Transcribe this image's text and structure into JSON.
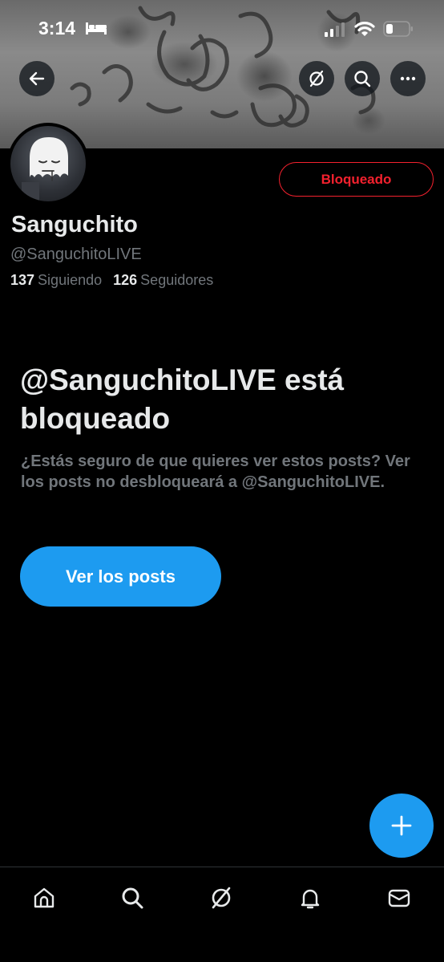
{
  "status_bar": {
    "time": "3:14",
    "icons": [
      "bed-icon",
      "signal-icon",
      "wifi-icon",
      "battery-icon"
    ]
  },
  "header": {
    "icons": [
      "back-arrow-icon",
      "grok-icon",
      "search-icon",
      "more-icon"
    ]
  },
  "profile": {
    "display_name": "Sanguchito",
    "handle": "@SanguchitoLIVE",
    "following_count": "137",
    "following_label": "Siguiendo",
    "followers_count": "126",
    "followers_label": "Seguidores",
    "blocked_button_label": "Bloqueado"
  },
  "blocked_notice": {
    "title": "@SanguchitoLIVE está bloqueado",
    "description": "¿Estás seguro de que quieres ver estos posts? Ver los posts no desbloqueará a @SanguchitoLIVE.",
    "button_label": "Ver los posts"
  },
  "fab": {
    "icon": "plus-icon"
  },
  "bottom_nav": {
    "items": [
      "home-icon",
      "search-icon",
      "grok-icon",
      "bell-icon",
      "mail-icon"
    ]
  },
  "colors": {
    "accent": "#1d9bf0",
    "blocked_red": "#f4212e",
    "muted_text": "#71767b",
    "primary_text": "#e7e9ea",
    "background": "#000000"
  }
}
